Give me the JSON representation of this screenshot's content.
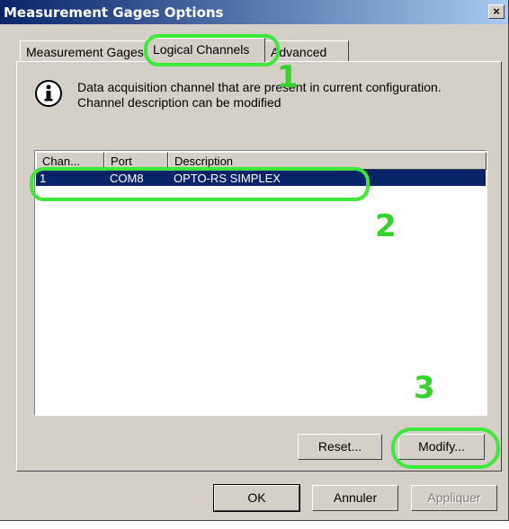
{
  "window": {
    "title": "Measurement Gages Options",
    "close_glyph": "×"
  },
  "tabs": [
    "Measurement Gages",
    "Logical Channels",
    "Advanced"
  ],
  "info": {
    "icon": "info-icon",
    "line1": "Data acquisition channel that are present in current configuration.",
    "line2": "Channel description can be modified"
  },
  "table": {
    "columns": [
      "Chan...",
      "Port",
      "Description"
    ],
    "rows": [
      {
        "chan": "1",
        "port": "COM8",
        "description": "OPTO-RS SIMPLEX"
      }
    ]
  },
  "panel_buttons": {
    "reset": "Reset...",
    "modify": "Modify..."
  },
  "footer_buttons": {
    "ok": "OK",
    "cancel": "Annuler",
    "apply": "Appliquer"
  },
  "annotations": {
    "one": "1",
    "two": "2",
    "three": "3",
    "highlight_color": "#3ee83a"
  }
}
